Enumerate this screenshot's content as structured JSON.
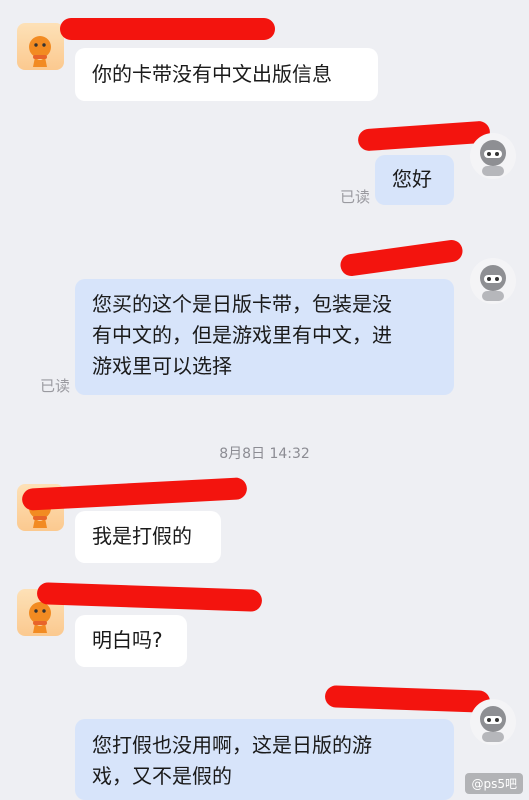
{
  "messages": [
    {
      "side": "left",
      "text": "你的卡带没有中文出版信息"
    },
    {
      "side": "right",
      "text": "您好",
      "status": "已读"
    },
    {
      "side": "right",
      "text": "您买的这个是日版卡带，包装是没有中文的，但是游戏里有中文，进游戏里可以选择",
      "lines": [
        "您买的这个是日版卡带，包装是没",
        "有中文的，但是游戏里有中文，进",
        "游戏里可以选择"
      ],
      "status": "已读"
    },
    {
      "side": "left",
      "text": "我是打假的"
    },
    {
      "side": "left",
      "text": "明白吗?"
    },
    {
      "side": "right",
      "text": "您打假也没用啊，这是日版的游戏，又不是假的",
      "lines": [
        "您打假也没用啊，这是日版的游",
        "戏，又不是假的"
      ]
    }
  ],
  "timestamp": "8月8日 14:32",
  "watermark": "@ps5吧",
  "colors": {
    "background": "#eeeff3",
    "incoming_bubble": "#ffffff",
    "outgoing_bubble": "#d7e4fa",
    "redaction": "#f3140e"
  },
  "icons": {
    "left_avatar": "orange-mascot-avatar-icon",
    "right_avatar": "robot-avatar-icon"
  }
}
